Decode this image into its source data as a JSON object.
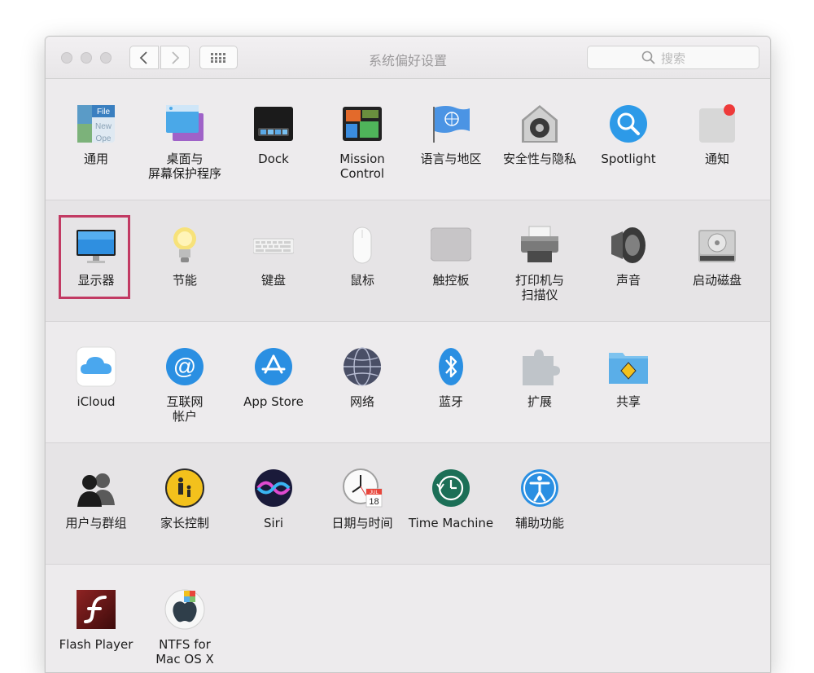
{
  "window": {
    "title": "系统偏好设置",
    "search_placeholder": "搜索",
    "accent": "#c23a63"
  },
  "rows": [
    [
      {
        "label": "通用",
        "icon": "general-icon"
      },
      {
        "label": "桌面与\n屏幕保护程序",
        "icon": "desktop-screensaver-icon"
      },
      {
        "label": "Dock",
        "icon": "dock-icon"
      },
      {
        "label": "Mission\nControl",
        "icon": "mission-control-icon"
      },
      {
        "label": "语言与地区",
        "icon": "language-region-icon"
      },
      {
        "label": "安全性与隐私",
        "icon": "security-privacy-icon"
      },
      {
        "label": "Spotlight",
        "icon": "spotlight-icon"
      },
      {
        "label": "通知",
        "icon": "notifications-icon"
      }
    ],
    [
      {
        "label": "显示器",
        "icon": "displays-icon"
      },
      {
        "label": "节能",
        "icon": "energy-saver-icon"
      },
      {
        "label": "键盘",
        "icon": "keyboard-icon"
      },
      {
        "label": "鼠标",
        "icon": "mouse-icon"
      },
      {
        "label": "触控板",
        "icon": "trackpad-icon"
      },
      {
        "label": "打印机与\n扫描仪",
        "icon": "printers-scanners-icon"
      },
      {
        "label": "声音",
        "icon": "sound-icon"
      },
      {
        "label": "启动磁盘",
        "icon": "startup-disk-icon"
      }
    ],
    [
      {
        "label": "iCloud",
        "icon": "icloud-icon"
      },
      {
        "label": "互联网\n帐户",
        "icon": "internet-accounts-icon"
      },
      {
        "label": "App Store",
        "icon": "app-store-icon"
      },
      {
        "label": "网络",
        "icon": "network-icon"
      },
      {
        "label": "蓝牙",
        "icon": "bluetooth-icon"
      },
      {
        "label": "扩展",
        "icon": "extensions-icon"
      },
      {
        "label": "共享",
        "icon": "sharing-icon"
      }
    ],
    [
      {
        "label": "用户与群组",
        "icon": "users-groups-icon"
      },
      {
        "label": "家长控制",
        "icon": "parental-controls-icon"
      },
      {
        "label": "Siri",
        "icon": "siri-icon"
      },
      {
        "label": "日期与时间",
        "icon": "date-time-icon"
      },
      {
        "label": "Time Machine",
        "icon": "time-machine-icon"
      },
      {
        "label": "辅助功能",
        "icon": "accessibility-icon"
      }
    ],
    [
      {
        "label": "Flash Player",
        "icon": "flash-player-icon"
      },
      {
        "label": "NTFS for\nMac OS X",
        "icon": "ntfs-icon"
      }
    ]
  ],
  "icon_text": {
    "general_file": "File",
    "general_new": "New",
    "general_open": "Ope",
    "calendar_month": "JUL",
    "calendar_day": "18"
  }
}
